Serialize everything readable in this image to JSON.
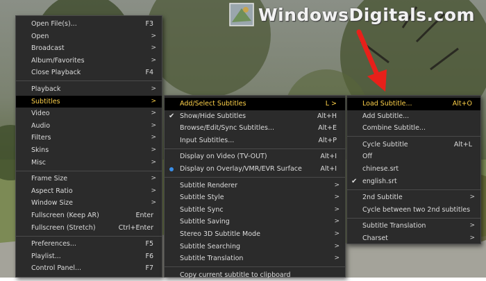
{
  "watermark": {
    "text": "WindowsDigitals.com"
  },
  "colors": {
    "highlight_bg": "#000000",
    "highlight_text": "#ffd24a",
    "menu_bg": "#2b2b2b",
    "radio_dot": "#3a8ee8",
    "arrow": "#e8201a"
  },
  "menu1": [
    {
      "label": "Open File(s)...",
      "shortcut": "F3"
    },
    {
      "label": "Open",
      "arrow": ">"
    },
    {
      "label": "Broadcast",
      "arrow": ">"
    },
    {
      "label": "Album/Favorites",
      "arrow": ">"
    },
    {
      "label": "Close Playback",
      "shortcut": "F4"
    },
    {
      "sep": true
    },
    {
      "label": "Playback",
      "arrow": ">"
    },
    {
      "label": "Subtitles",
      "arrow": ">",
      "highlight": true
    },
    {
      "label": "Video",
      "arrow": ">"
    },
    {
      "label": "Audio",
      "arrow": ">"
    },
    {
      "label": "Filters",
      "arrow": ">"
    },
    {
      "label": "Skins",
      "arrow": ">"
    },
    {
      "label": "Misc",
      "arrow": ">"
    },
    {
      "sep": true
    },
    {
      "label": "Frame Size",
      "arrow": ">"
    },
    {
      "label": "Aspect Ratio",
      "arrow": ">"
    },
    {
      "label": "Window Size",
      "arrow": ">"
    },
    {
      "label": "Fullscreen (Keep AR)",
      "shortcut": "Enter"
    },
    {
      "label": "Fullscreen (Stretch)",
      "shortcut": "Ctrl+Enter"
    },
    {
      "sep": true
    },
    {
      "label": "Preferences...",
      "shortcut": "F5"
    },
    {
      "label": "Playlist...",
      "shortcut": "F6"
    },
    {
      "label": "Control Panel...",
      "shortcut": "F7"
    }
  ],
  "menu2": [
    {
      "label": "Add/Select Subtitles",
      "shortcut": "L >",
      "highlight": true
    },
    {
      "label": "Show/Hide Subtitles",
      "shortcut": "Alt+H",
      "mark": "check"
    },
    {
      "label": "Browse/Edit/Sync Subtitles...",
      "shortcut": "Alt+E"
    },
    {
      "label": "Input Subtitles...",
      "shortcut": "Alt+P"
    },
    {
      "sep": true
    },
    {
      "label": "Display on Video (TV-OUT)",
      "shortcut": "Alt+I"
    },
    {
      "label": "Display on Overlay/VMR/EVR Surface",
      "shortcut": "Alt+I",
      "mark": "dot"
    },
    {
      "sep": true
    },
    {
      "label": "Subtitle Renderer",
      "arrow": ">"
    },
    {
      "label": "Subtitle Style",
      "arrow": ">"
    },
    {
      "label": "Subtitle Sync",
      "arrow": ">"
    },
    {
      "label": "Subtitle Saving",
      "arrow": ">"
    },
    {
      "label": "Stereo 3D Subtitle Mode",
      "arrow": ">"
    },
    {
      "label": "Subtitle Searching",
      "arrow": ">"
    },
    {
      "label": "Subtitle Translation",
      "arrow": ">"
    },
    {
      "sep": true
    },
    {
      "label": "Copy current subtitle to clipboard"
    }
  ],
  "menu3": [
    {
      "label": "Load Subtitle...",
      "shortcut": "Alt+O",
      "highlight": true
    },
    {
      "label": "Add Subtitle..."
    },
    {
      "label": "Combine Subtitle..."
    },
    {
      "sep": true
    },
    {
      "label": "Cycle Subtitle",
      "shortcut": "Alt+L"
    },
    {
      "label": "Off"
    },
    {
      "label": "chinese.srt"
    },
    {
      "label": "english.srt",
      "mark": "check"
    },
    {
      "sep": true
    },
    {
      "label": "2nd Subtitle",
      "arrow": ">"
    },
    {
      "label": "Cycle between two 2nd subtitles"
    },
    {
      "sep": true
    },
    {
      "label": "Subtitle Translation",
      "arrow": ">"
    },
    {
      "label": "Charset",
      "arrow": ">"
    }
  ]
}
